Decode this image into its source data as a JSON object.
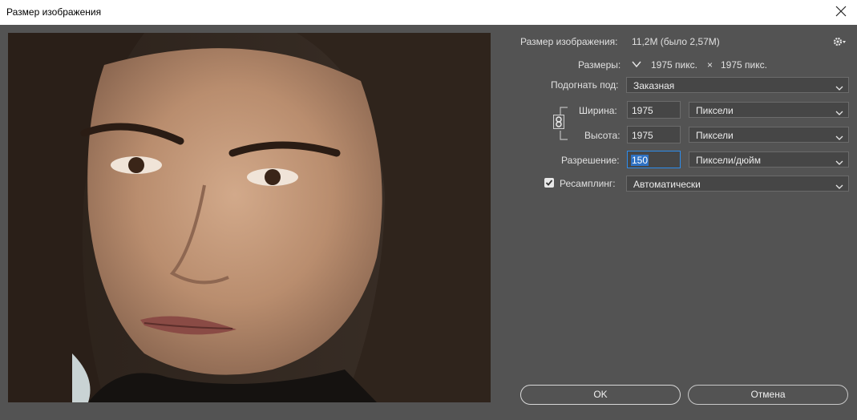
{
  "window": {
    "title": "Размер изображения"
  },
  "info": {
    "size_label": "Размер изображения:",
    "size_value": "11,2M (было 2,57M)",
    "dims_label": "Размеры:",
    "dims_width": "1975 пикс.",
    "dims_times": "×",
    "dims_height": "1975 пикс."
  },
  "fit": {
    "label": "Подогнать под:",
    "value": "Заказная"
  },
  "width": {
    "label": "Ширина:",
    "value": "1975",
    "unit": "Пиксели"
  },
  "height": {
    "label": "Высота:",
    "value": "1975",
    "unit": "Пиксели"
  },
  "resolution": {
    "label": "Разрешение:",
    "value": "150",
    "unit": "Пиксели/дюйм"
  },
  "resample": {
    "label": "Ресамплинг:",
    "checked": true,
    "value": "Автоматически"
  },
  "buttons": {
    "ok": "OK",
    "cancel": "Отмена"
  },
  "icons": {
    "close": "close-icon",
    "gear": "gear-icon",
    "link": "chain-link-icon",
    "dropdown": "chevron-down-icon",
    "check": "checkmark-icon"
  },
  "colors": {
    "dialog_bg": "#535353",
    "field_bg": "#464646",
    "focus_border": "#2d8ceb",
    "selection": "#2f72c4"
  }
}
